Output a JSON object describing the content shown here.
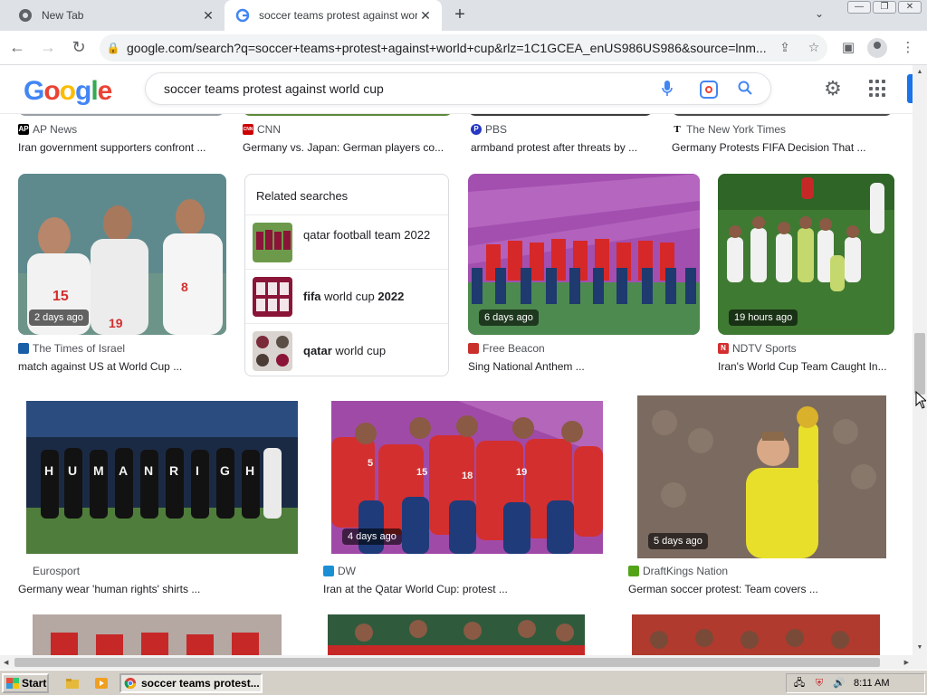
{
  "browser": {
    "tabs": [
      {
        "title": "New Tab"
      },
      {
        "title": "soccer teams protest against world"
      }
    ],
    "url": "google.com/search?q=soccer+teams+protest+against+world+cup&rlz=1C1GCEA_enUS986US986&source=lnm..."
  },
  "google": {
    "logo_letters": [
      "G",
      "o",
      "o",
      "g",
      "l",
      "e"
    ],
    "query": "soccer teams protest against world cup"
  },
  "results": {
    "top_row": [
      {
        "source": "AP News",
        "caption": "Iran government supporters confront ...",
        "favicon": "AP",
        "favicon_color": "#000000"
      },
      {
        "source": "CNN",
        "caption": "Germany vs. Japan: German players co...",
        "favicon": "CNN",
        "favicon_color": "#cc0000"
      },
      {
        "source": "PBS",
        "caption": "armband protest after threats by ...",
        "favicon": "P",
        "favicon_color": "#2638c4"
      },
      {
        "source": "The New York Times",
        "caption": "Germany Protests FIFA Decision That ...",
        "favicon": "T",
        "favicon_color": "#000000"
      }
    ],
    "row2": [
      {
        "source": "The Times of Israel",
        "caption": "match against US at World Cup ...",
        "badge": "2 days ago",
        "favicon_color": "#1a5ea8"
      },
      {
        "source": "Free Beacon",
        "caption": "Sing National Anthem ...",
        "badge": "6 days ago",
        "favicon_color": "#c9302c"
      },
      {
        "source": "NDTV Sports",
        "caption": "Iran's World Cup Team Caught In...",
        "badge": "19 hours ago",
        "favicon": "N",
        "favicon_color": "#d32f2f"
      }
    ],
    "related": {
      "title": "Related searches",
      "items": [
        {
          "bold": "",
          "text": "qatar football team 2022"
        },
        {
          "bold": "fifa",
          "text": " world cup ",
          "bold2": "2022"
        },
        {
          "bold": "qatar",
          "text": " world cup"
        }
      ]
    },
    "row3": [
      {
        "source": "Eurosport",
        "caption": "Germany wear 'human rights' shirts ...",
        "badge": ""
      },
      {
        "source": "DW",
        "caption": "Iran at the Qatar World Cup: protest ...",
        "badge": "4 days ago",
        "favicon_color": "#1a8fd4"
      },
      {
        "source": "DraftKings Nation",
        "caption": "German soccer protest: Team covers ...",
        "badge": "5 days ago",
        "favicon_color": "#53a318"
      }
    ]
  },
  "taskbar": {
    "start_label": "Start",
    "task_label": "soccer teams protest...",
    "clock": "8:11 AM"
  },
  "colors": {
    "accent": "#1a73e8",
    "taskbar": "#d4d0c8"
  }
}
